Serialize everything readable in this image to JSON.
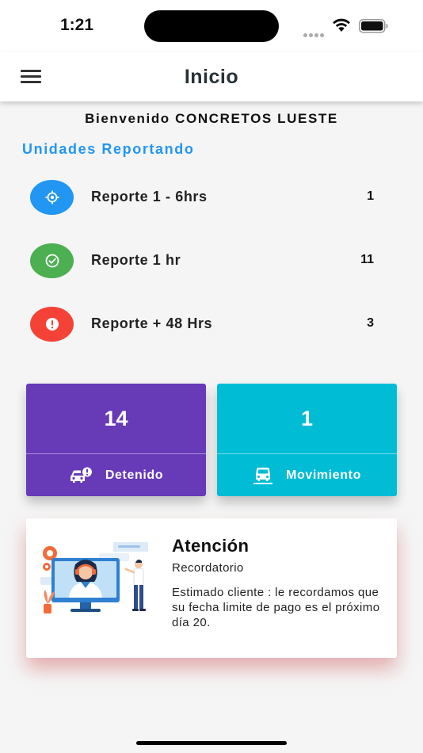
{
  "status_bar": {
    "time": "1:21"
  },
  "app_bar": {
    "title": "Inicio"
  },
  "welcome": "Bienvenido CONCRETOS LUESTE",
  "section_title": "Unidades Reportando",
  "reports": [
    {
      "label": "Reporte 1 - 6hrs",
      "count": "1",
      "color": "#2196F3",
      "icon": "location-target-icon"
    },
    {
      "label": "Reporte 1 hr",
      "count": "11",
      "color": "#4CAF50",
      "icon": "check-circle-icon"
    },
    {
      "label": "Reporte + 48 Hrs",
      "count": "3",
      "color": "#F44336",
      "icon": "alert-circle-icon"
    }
  ],
  "stats": [
    {
      "value": "14",
      "label": "Detenido",
      "color": "#673AB7",
      "icon": "car-alert-icon"
    },
    {
      "value": "1",
      "label": "Movimiento",
      "color": "#00BCD4",
      "icon": "car-moving-icon"
    }
  ],
  "notice": {
    "title": "Atención",
    "subtitle": "Recordatorio",
    "body": "Estimado cliente : le recordamos que su fecha limite de pago es el próximo día 20.",
    "illustration": "customer-support-illustration"
  }
}
